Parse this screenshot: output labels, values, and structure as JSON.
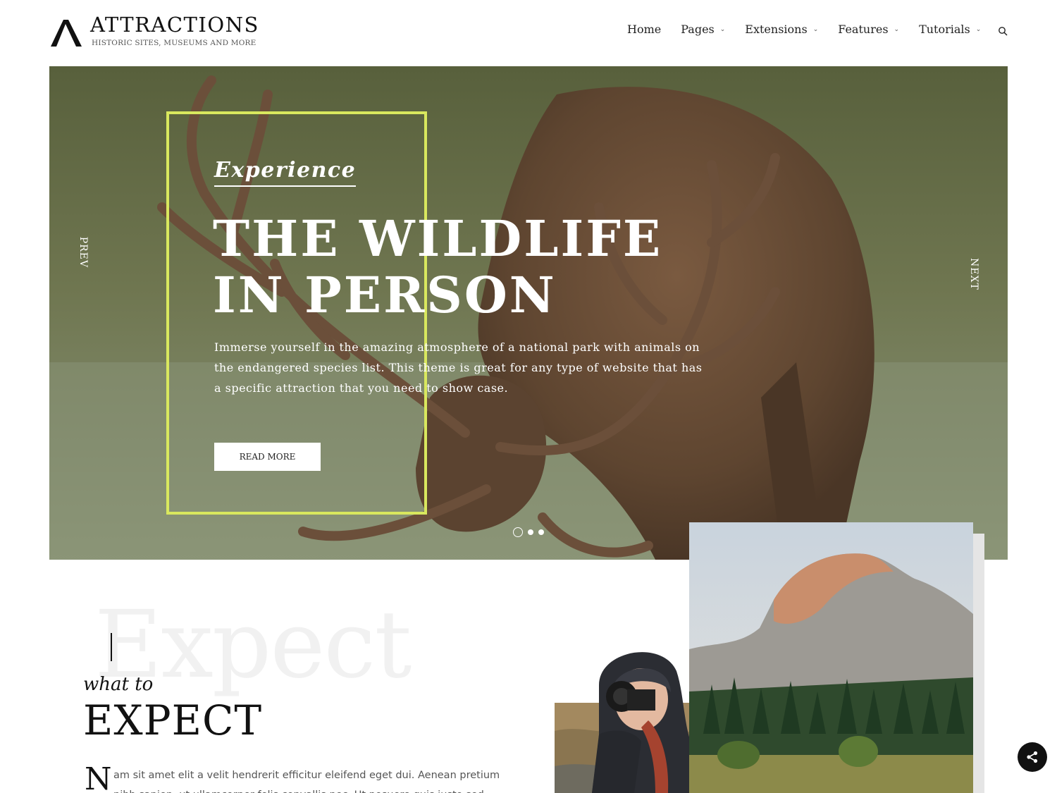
{
  "brand": {
    "title": "ATTRACTIONS",
    "tagline": "HISTORIC SITES, MUSEUMS AND MORE",
    "logo_icon": "lambda-logo-icon"
  },
  "nav": {
    "items": [
      {
        "label": "Home",
        "has_dropdown": false
      },
      {
        "label": "Pages",
        "has_dropdown": true
      },
      {
        "label": "Extensions",
        "has_dropdown": true
      },
      {
        "label": "Features",
        "has_dropdown": true
      },
      {
        "label": "Tutorials",
        "has_dropdown": true
      }
    ],
    "search_icon": "search-icon"
  },
  "hero": {
    "kicker": "Experience",
    "title_line1": "THE WILDLIFE",
    "title_line2": "IN PERSON",
    "description": "Immerse yourself in the amazing atmosphere of a national park with animals on the endangered species list. This theme is great for any type of website that has a specific attraction that you need to show case.",
    "button_label": "READ MORE",
    "prev_label": "PREV",
    "next_label": "NEXT",
    "slides_total": 3,
    "active_slide": 1,
    "frame_color": "#d9e85e"
  },
  "expect": {
    "ghost_word": "Expect",
    "subtitle": "what to",
    "heading": "EXPECT",
    "dropcap": "N",
    "body": "am sit amet elit a velit hendrerit efficitur eleifend eget dui. Aenean pretium nibh sapien, ut ullamcorper felis convallis nec. Ut posuere quis justo sed commodo."
  },
  "share": {
    "icon": "share-icon"
  }
}
